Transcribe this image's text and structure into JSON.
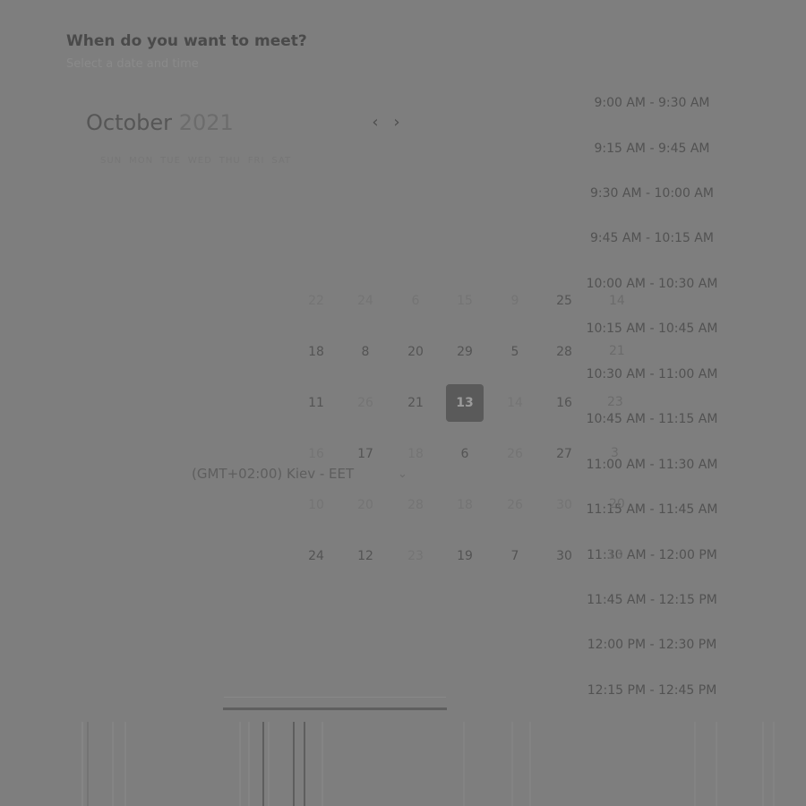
{
  "question": {
    "title": "When do you want to meet?",
    "subtitle": "Select a date and time"
  },
  "calendar": {
    "month": "October",
    "year": "2021",
    "prev_icon": "chevron-left-icon",
    "next_icon": "chevron-right-icon",
    "weekdays": [
      "SUN",
      "MON",
      "TUE",
      "WED",
      "THU",
      "FRI",
      "SAT"
    ],
    "row1": [
      "22",
      "24",
      "6",
      "15",
      "9",
      "25"
    ],
    "row2": [
      "18",
      "8",
      "20",
      "29",
      "5",
      "28"
    ],
    "row3": [
      "11",
      "26",
      "21",
      "13",
      "14",
      "16"
    ],
    "row4": [
      "16",
      "17",
      "18",
      "6",
      "26",
      "27"
    ],
    "row5": [
      "10",
      "20",
      "28",
      "18",
      "26",
      "30"
    ],
    "row6": [
      "24",
      "12",
      "23",
      "19",
      "7",
      "30"
    ],
    "selected_day": "13"
  },
  "timezone": {
    "label": "(GMT+02:00) Kiev - EET",
    "chevron_icon": "chevron-down-icon"
  },
  "time_slots": [
    "9:00 AM - 9:30 AM",
    "9:15 AM - 9:45 AM",
    "9:30 AM - 10:00 AM",
    "9:45 AM - 10:15 AM",
    "10:00 AM - 10:30 AM",
    "10:15 AM - 10:45 AM",
    "10:30 AM - 11:00 AM",
    "10:45 AM - 11:15 AM",
    "11:00 AM - 11:30 AM",
    "11:15 AM - 11:45 AM",
    "11:30 AM - 12:00 PM",
    "11:45 AM - 12:15 PM",
    "12:00 PM - 12:30 PM",
    "12:15 PM - 12:45 PM"
  ],
  "overlay_numbers": [
    "14",
    "21",
    "23",
    "3",
    "20",
    "13"
  ]
}
